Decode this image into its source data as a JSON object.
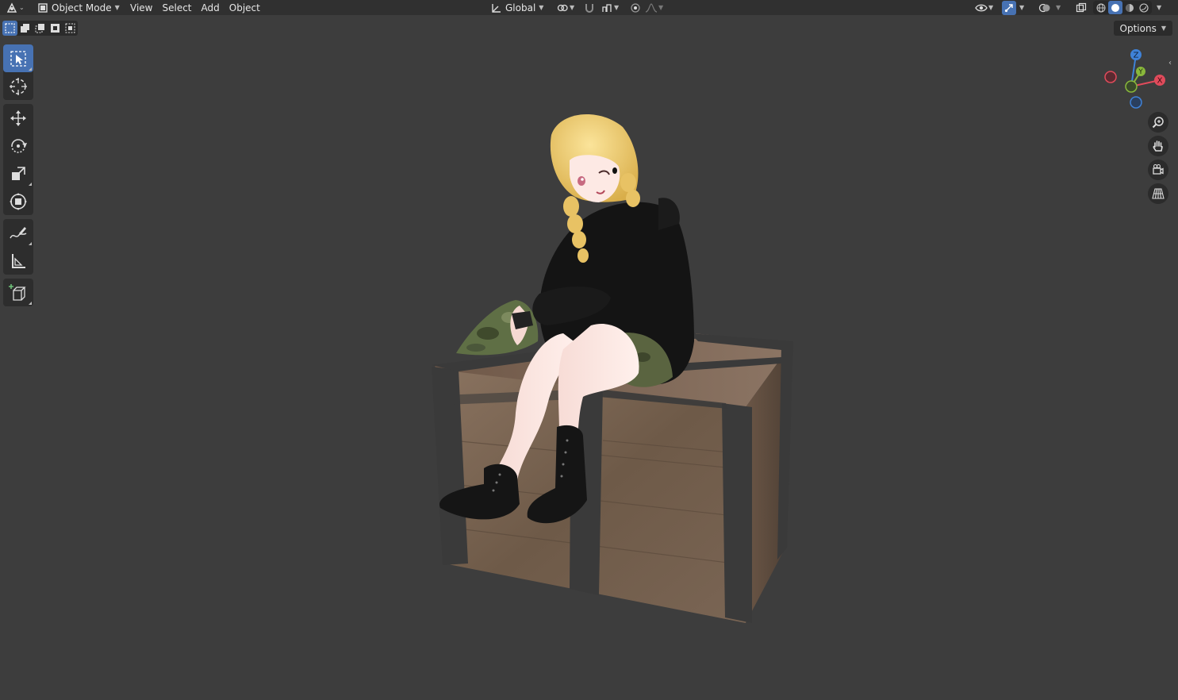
{
  "header": {
    "mode": "Object Mode",
    "menus": [
      "View",
      "Select",
      "Add",
      "Object"
    ],
    "orientation": "Global"
  },
  "viewport": {
    "options_label": "Options",
    "gizmo": {
      "z": "Z",
      "y": "Y",
      "x": "X"
    }
  },
  "colors": {
    "accent": "#4772b3",
    "axis_x": "#e04b5b",
    "axis_y": "#89b83b",
    "axis_z": "#3f82d8",
    "viewport_bg": "#3d3d3d"
  },
  "toolbar": {
    "tools": [
      "select-box-icon",
      "cursor-icon",
      "move-icon",
      "rotate-icon",
      "scale-icon",
      "transform-icon",
      "annotate-icon",
      "measure-icon",
      "add-cube-icon"
    ]
  }
}
